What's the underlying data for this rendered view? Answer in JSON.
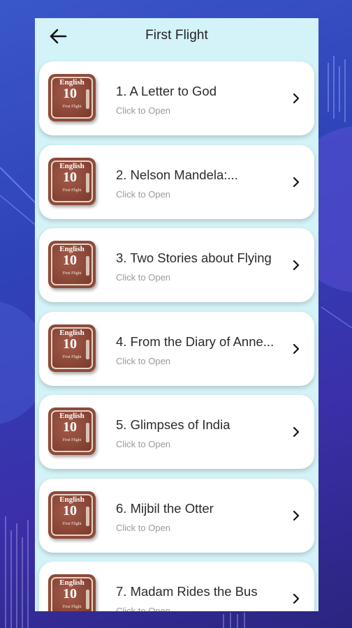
{
  "header": {
    "title": "First Flight",
    "back_icon": "arrow-left-icon"
  },
  "thumbnail": {
    "line1": "English",
    "line2": "10",
    "line3": "First Flight"
  },
  "items": [
    {
      "title": "1. A Letter to God",
      "subtitle": "Click to Open"
    },
    {
      "title": "2. Nelson Mandela:...",
      "subtitle": "Click to Open"
    },
    {
      "title": "3. Two Stories about Flying",
      "subtitle": "Click to Open"
    },
    {
      "title": "4. From the Diary of Anne...",
      "subtitle": "Click to Open"
    },
    {
      "title": "5. Glimpses of India",
      "subtitle": "Click to Open"
    },
    {
      "title": "6. Mijbil the Otter",
      "subtitle": "Click to Open"
    },
    {
      "title": "7. Madam Rides the Bus",
      "subtitle": "Click to Open"
    }
  ],
  "colors": {
    "screen_bg": "#d3f3f8",
    "card_bg": "#ffffff",
    "thumb_bg": "#8e4a3a"
  }
}
